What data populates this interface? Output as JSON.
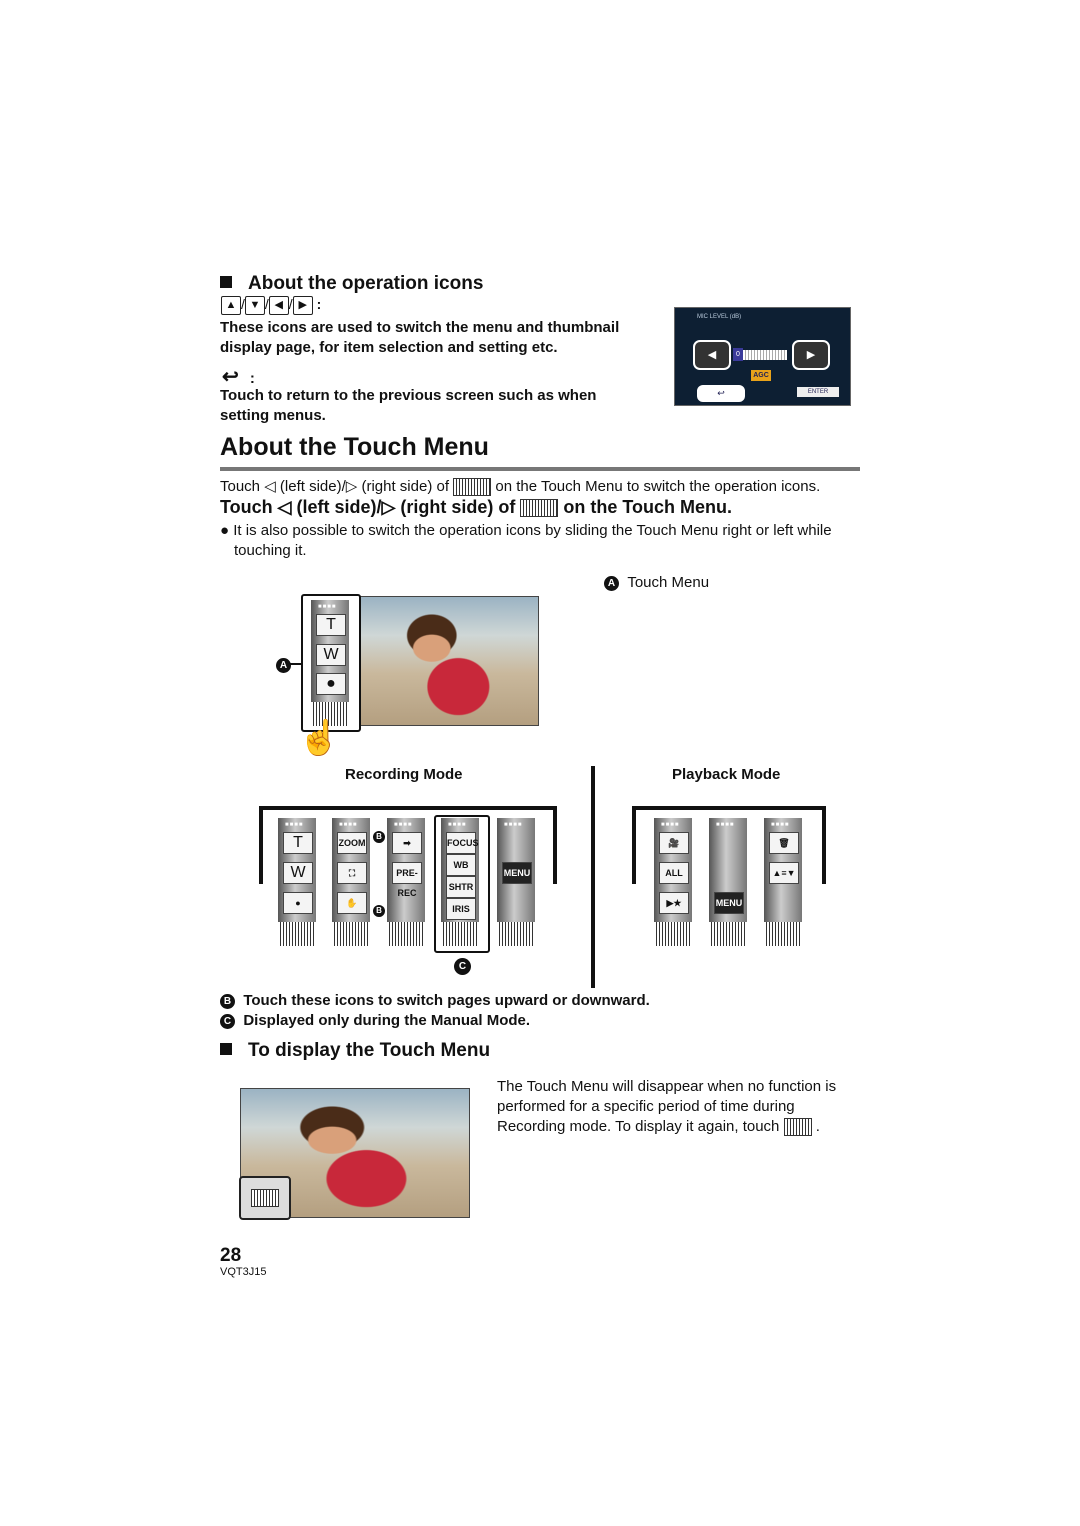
{
  "operation_icons": {
    "heading": "About the operation icons",
    "arrow_keys": [
      "▲",
      "▼",
      "◀",
      "▶"
    ],
    "arrow_colon": ":",
    "arrow_desc": "These icons are used to switch the menu and thumbnail display page, for item selection and setting etc.",
    "return_icon": "↩",
    "return_colon": ":",
    "return_desc": "Touch to return to the previous screen such as when setting menus.",
    "screen": {
      "title": "MIC LEVEL (dB)",
      "value": "0",
      "agc": "AGC",
      "enter": "ENTER"
    }
  },
  "touch_menu": {
    "title": "About the Touch Menu",
    "intro_pre": "Touch",
    "intro_left": "(left side)/",
    "intro_right": "(right side) of",
    "intro_post": "on the Touch Menu to switch the operation icons.",
    "step_pre": "Touch",
    "step_left": "(left side)/",
    "step_right": "(right side) of",
    "step_post": "on the Touch Menu.",
    "note": "It is also possible to switch the operation icons by sliding the Touch Menu right or left while touching it.",
    "label_a": "A",
    "label_a_text": "Touch Menu",
    "preview_buttons": [
      "T",
      "W",
      "●"
    ],
    "recording_mode": "Recording Mode",
    "playback_mode": "Playback Mode",
    "recording_tiles": [
      {
        "buttons": [
          "T",
          "W",
          "●"
        ]
      },
      {
        "buttons": [
          "ZOOM",
          "⛶",
          "✋"
        ]
      },
      {
        "buttons": [
          "➡",
          "PRE-REC",
          ""
        ]
      },
      {
        "buttons": [
          "FOCUS",
          "WB",
          "SHTR",
          "IRIS"
        ]
      },
      {
        "buttons": [
          "",
          "MENU",
          ""
        ]
      }
    ],
    "playback_tiles": [
      {
        "buttons": [
          "🎥",
          "ALL",
          "▶★"
        ]
      },
      {
        "buttons": [
          "",
          "",
          "MENU"
        ]
      },
      {
        "buttons": [
          "🗑",
          "▲≡▼",
          ""
        ]
      }
    ],
    "label_b": "B",
    "label_c": "C",
    "legend_b": "Touch these icons to switch pages upward or downward.",
    "legend_c": "Displayed only during the Manual Mode."
  },
  "display": {
    "heading": "To display the Touch Menu",
    "text": "The Touch Menu will disappear when no function is performed for a specific period of time during Recording mode. To display it again, touch",
    "text_end": "."
  },
  "footer": {
    "page": "28",
    "code": "VQT3J15"
  }
}
